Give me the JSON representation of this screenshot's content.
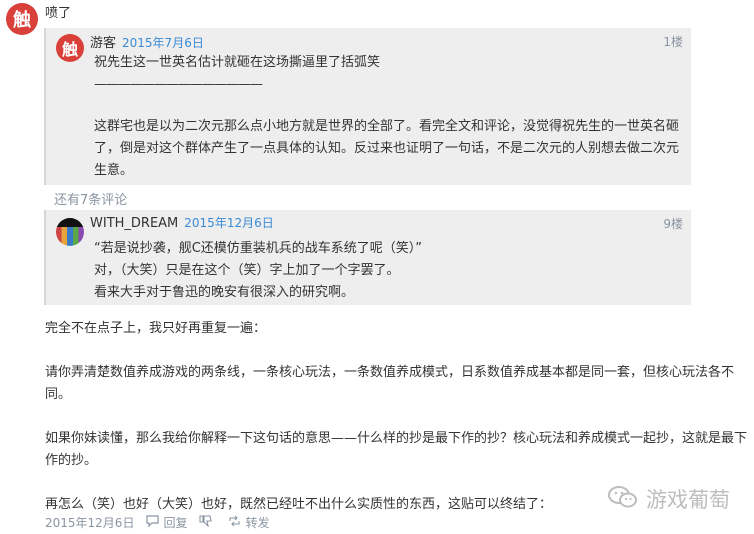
{
  "outer": {
    "avatar": "触",
    "text": "喷了"
  },
  "quote1": {
    "avatar": "触",
    "username": "游客",
    "date": "2015年7月6日",
    "floor": "1楼",
    "line1": "祝先生这一世英名估计就砸在这场撕逼里了括弧笑",
    "line2": "——————————————",
    "para": "这群宅也是以为二次元那么点小地方就是世界的全部了。看完全文和评论，没觉得祝先生的一世英名砸了，倒是对这个群体产生了一点具体的认知。反过来也证明了一句话，不是二次元的人别想去做二次元生意。"
  },
  "more_comments": "还有7条评论",
  "quote2": {
    "username": "WITH_DREAM",
    "date": "2015年12月6日",
    "floor": "9楼",
    "lines": [
      "“若是说抄袭，舰C还模仿重装机兵的战车系统了呢（笑）”",
      "对，（大笑）只是在这个（笑）字上加了一个字罢了。",
      "看来大手对于鲁迅的晚安有很深入的研究啊。"
    ]
  },
  "reply": {
    "p1": "完全不在点子上，我只好再重复一遍：",
    "p2": "请你弄清楚数值养成游戏的两条线，一条核心玩法，一条数值养成模式，日系数值养成基本都是同一套，但核心玩法各不同。",
    "p3": "如果你妹读懂，那么我给你解释一下这句话的意思——什么样的抄是最下作的抄？核心玩法和养成模式一起抄，这就是最下作的抄。",
    "p4": "再怎么（笑）也好（大笑）也好，既然已经吐不出什么实质性的东西，这贴可以终结了："
  },
  "footer": {
    "date": "2015年12月6日",
    "reply": "回复",
    "repost": "转发"
  },
  "watermark": "游戏葡萄"
}
